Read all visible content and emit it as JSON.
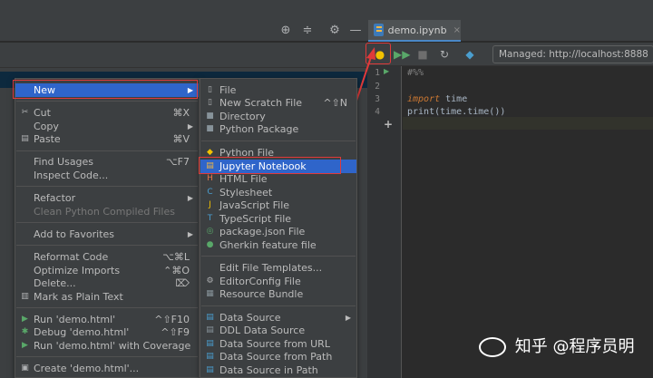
{
  "tab": {
    "label": "demo.ipynb",
    "close": "×"
  },
  "toolbar_icons": [
    "target-icon",
    "collapse-icon",
    "gear-icon",
    "minimize-icon"
  ],
  "notebook_toolbar": {
    "server": "Managed: http://localhost:8888"
  },
  "editor": {
    "lines": [
      {
        "num": "1",
        "comment": "#%%"
      },
      {
        "num": "2"
      },
      {
        "num": "3",
        "kw": "import",
        "rest": " time"
      },
      {
        "num": "4",
        "rest": "print(time.time())"
      }
    ],
    "add_cell": "+",
    "run_marker": "▶"
  },
  "menu1": {
    "new": "New",
    "cut": "Cut",
    "cut_sc": "⌘X",
    "copy": "Copy",
    "paste": "Paste",
    "paste_sc": "⌘V",
    "find_usages": "Find Usages",
    "find_usages_sc": "⌥F7",
    "inspect_code": "Inspect Code...",
    "refactor": "Refactor",
    "clean_python": "Clean Python Compiled Files",
    "add_favorites": "Add to Favorites",
    "reformat": "Reformat Code",
    "reformat_sc": "⌥⌘L",
    "optimize": "Optimize Imports",
    "optimize_sc": "⌃⌘O",
    "delete": "Delete...",
    "delete_sc": "⌦",
    "mark_plain": "Mark as Plain Text",
    "run": "Run 'demo.html'",
    "run_sc": "^⇧F10",
    "debug": "Debug 'demo.html'",
    "debug_sc": "^⇧F9",
    "run_cov": "Run 'demo.html' with Coverage",
    "create": "Create 'demo.html'..."
  },
  "menu2": {
    "file": "File",
    "scratch": "New Scratch File",
    "scratch_sc": "^⇧N",
    "directory": "Directory",
    "python_package": "Python Package",
    "python_file": "Python File",
    "jupyter": "Jupyter Notebook",
    "html_file": "HTML File",
    "stylesheet": "Stylesheet",
    "js_file": "JavaScript File",
    "ts_file": "TypeScript File",
    "package_json": "package.json File",
    "gherkin": "Gherkin feature file",
    "edit_templates": "Edit File Templates...",
    "editorconfig": "EditorConfig File",
    "resource_bundle": "Resource Bundle",
    "data_source": "Data Source",
    "ddl_source": "DDL Data Source",
    "ds_url": "Data Source from URL",
    "ds_path": "Data Source from Path",
    "ds_in_path": "Data Source in Path"
  },
  "watermark": "知乎 @程序员明"
}
